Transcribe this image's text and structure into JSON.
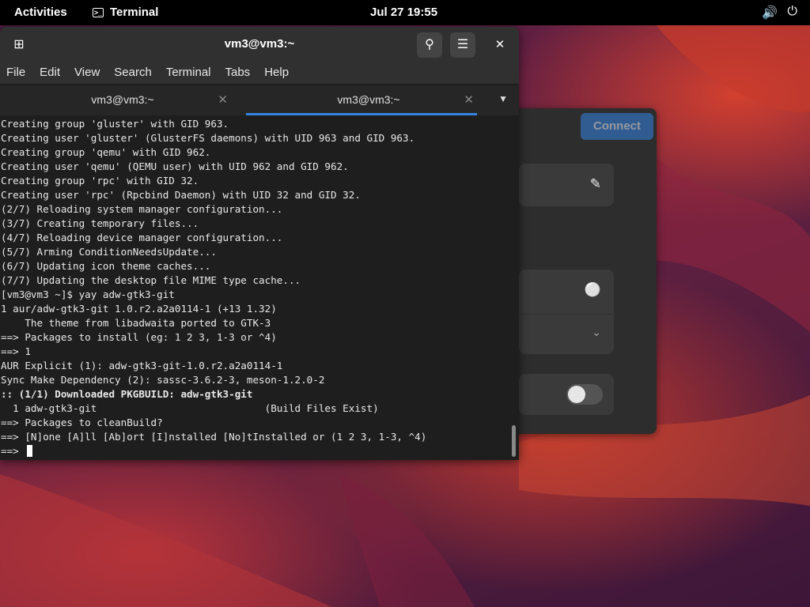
{
  "topbar": {
    "activities": "Activities",
    "app_name": "Terminal",
    "clock": "Jul 27  19:55"
  },
  "icons": {
    "terminal_app": "terminal-icon",
    "volume": "speaker-icon",
    "power": "power-icon",
    "new_tab": "new-tab-icon",
    "search": "search-icon",
    "menu": "hamburger-icon",
    "close": "close-icon",
    "pencil": "pencil-icon",
    "bulb": "lightbulb-icon",
    "chevron": "chevron-down-icon"
  },
  "terminal": {
    "title": "vm3@vm3:~",
    "menu": [
      "File",
      "Edit",
      "View",
      "Search",
      "Terminal",
      "Tabs",
      "Help"
    ],
    "tabs": [
      "vm3@vm3:~",
      "vm3@vm3:~"
    ],
    "active_tab": 1,
    "lines": [
      "Creating group 'gluster' with GID 963.",
      "Creating user 'gluster' (GlusterFS daemons) with UID 963 and GID 963.",
      "Creating group 'qemu' with GID 962.",
      "Creating user 'qemu' (QEMU user) with UID 962 and GID 962.",
      "Creating group 'rpc' with GID 32.",
      "Creating user 'rpc' (Rpcbind Daemon) with UID 32 and GID 32.",
      "(2/7) Reloading system manager configuration...",
      "(3/7) Creating temporary files...",
      "(4/7) Reloading device manager configuration...",
      "(5/7) Arming ConditionNeedsUpdate...",
      "(6/7) Updating icon theme caches...",
      "(7/7) Updating the desktop file MIME type cache...",
      "[vm3@vm3 ~]$ yay adw-gtk3-git",
      "1 aur/adw-gtk3-git 1.0.r2.a2a0114-1 (+13 1.32)",
      "    The theme from libadwaita ported to GTK-3",
      "==> Packages to install (eg: 1 2 3, 1-3 or ^4)",
      "==> 1",
      "AUR Explicit (1): adw-gtk3-git-1.0.r2.a2a0114-1",
      "Sync Make Dependency (2): sassc-3.6.2-3, meson-1.2.0-2",
      ":: (1/1) Downloaded PKGBUILD: adw-gtk3-git",
      "  1 adw-gtk3-git                            (Build Files Exist)",
      "==> Packages to cleanBuild?",
      "==> [N]one [A]ll [Ab]ort [I]nstalled [No]tInstalled or (1 2 3, 1-3, ^4)",
      "==> "
    ],
    "bold_line_index": 19
  },
  "settings_window": {
    "connect_label": "Connect",
    "toggle_on": false
  }
}
